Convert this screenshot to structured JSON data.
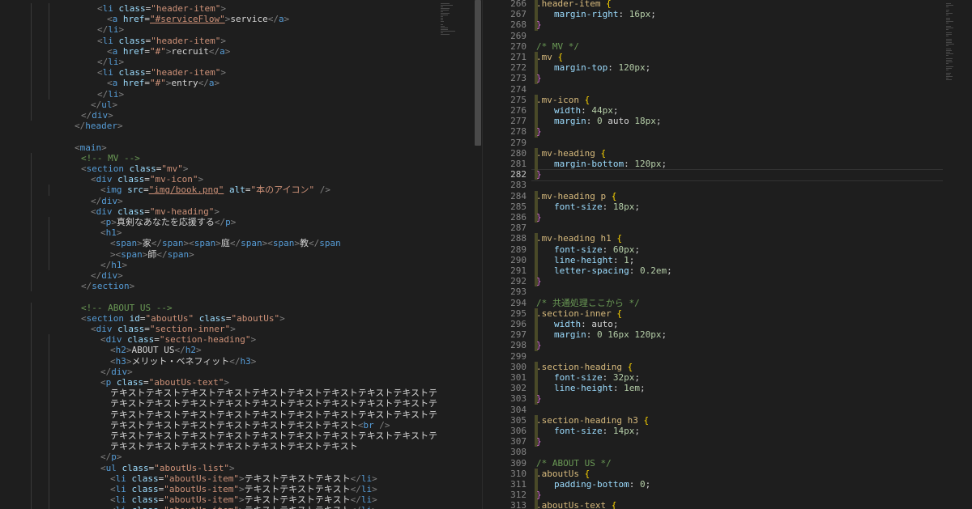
{
  "editor": {
    "left_pane": {
      "lines": [
        "<li class=\"header-item\">",
        "<a href=\"#serviceFlow\">service</a>",
        "</li>",
        "<li class=\"header-item\">",
        "<a href=\"#\">recruit</a>",
        "</li>",
        "<li class=\"header-item\">",
        "<a href=\"#\">entry</a>",
        "</li>",
        "</ul>",
        "</div>",
        "</header>",
        "",
        "<main>",
        "<!-- MV -->",
        "<section class=\"mv\">",
        "<div class=\"mv-icon\">",
        "<img src=\"img/book.png\" alt=\"本のアイコン\" />",
        "</div>",
        "<div class=\"mv-heading\">",
        "<p>真剣なあなたを応援する</p>",
        "<h1>",
        "<span>家</span><span>庭</span><span>教</span",
        "><span>師</span>",
        "</h1>",
        "</div>",
        "</section>",
        "",
        "<!-- ABOUT US -->",
        "<section id=\"aboutUs\" class=\"aboutUs\">",
        "<div class=\"section-inner\">",
        "<div class=\"section-heading\">",
        "<h2>ABOUT US</h2>",
        "<h3>メリット・ベネフィット</h3>",
        "</div>",
        "<p class=\"aboutUs-text\">",
        "テキストテキストテキストテキストテキストテキストテキストテキストテキストテキストテ",
        "テキストテキストテキストテキストテキストテキストテキストテキストテキストテキストテ",
        "テキストテキストテキストテキストテキストテキストテキストテキストテキストテキストテ",
        "テキストテキストテキストテキストテキストテキストテキスト<br />",
        "テキストテキストテキストテキストテキストテキストテキストテキストテキストテキストテ",
        "テキストテキストテキストテキストテキストテキストテキスト",
        "</p>",
        "<ul class=\"aboutUs-list\">",
        "<li class=\"aboutUs-item\">テキストテキストテキスト</li>",
        "<li class=\"aboutUs-item\">テキストテキストテキスト</li>",
        "<li class=\"aboutUs-item\">テキストテキストテキスト</li>",
        "<li class=\"aboutUs-item\">テキストテキストテキスト</li>"
      ]
    },
    "right_pane": {
      "active_line": "282",
      "lines": [
        {
          "n": "266",
          "t": ".header-item {"
        },
        {
          "n": "267",
          "t": "margin-right: 16px;"
        },
        {
          "n": "268",
          "t": "}"
        },
        {
          "n": "269",
          "t": ""
        },
        {
          "n": "270",
          "t": "/* MV */"
        },
        {
          "n": "271",
          "t": ".mv {"
        },
        {
          "n": "272",
          "t": "margin-top: 120px;"
        },
        {
          "n": "273",
          "t": "}"
        },
        {
          "n": "274",
          "t": ""
        },
        {
          "n": "275",
          "t": ".mv-icon {"
        },
        {
          "n": "276",
          "t": "width: 44px;"
        },
        {
          "n": "277",
          "t": "margin: 0 auto 18px;"
        },
        {
          "n": "278",
          "t": "}"
        },
        {
          "n": "279",
          "t": ""
        },
        {
          "n": "280",
          "t": ".mv-heading {"
        },
        {
          "n": "281",
          "t": "margin-bottom: 120px;"
        },
        {
          "n": "282",
          "t": "}"
        },
        {
          "n": "283",
          "t": ""
        },
        {
          "n": "284",
          "t": ".mv-heading p {"
        },
        {
          "n": "285",
          "t": "font-size: 18px;"
        },
        {
          "n": "286",
          "t": "}"
        },
        {
          "n": "287",
          "t": ""
        },
        {
          "n": "288",
          "t": ".mv-heading h1 {"
        },
        {
          "n": "289",
          "t": "font-size: 60px;"
        },
        {
          "n": "290",
          "t": "line-height: 1;"
        },
        {
          "n": "291",
          "t": "letter-spacing: 0.2em;"
        },
        {
          "n": "292",
          "t": "}"
        },
        {
          "n": "293",
          "t": ""
        },
        {
          "n": "294",
          "t": "/* 共通処理ここから */"
        },
        {
          "n": "295",
          "t": ".section-inner {"
        },
        {
          "n": "296",
          "t": "width: auto;"
        },
        {
          "n": "297",
          "t": "margin: 0 16px 120px;"
        },
        {
          "n": "298",
          "t": "}"
        },
        {
          "n": "299",
          "t": ""
        },
        {
          "n": "300",
          "t": ".section-heading {"
        },
        {
          "n": "301",
          "t": "font-size: 32px;"
        },
        {
          "n": "302",
          "t": "line-height: 1em;"
        },
        {
          "n": "303",
          "t": "}"
        },
        {
          "n": "304",
          "t": ""
        },
        {
          "n": "305",
          "t": ".section-heading h3 {"
        },
        {
          "n": "306",
          "t": "font-size: 14px;"
        },
        {
          "n": "307",
          "t": "}"
        },
        {
          "n": "308",
          "t": ""
        },
        {
          "n": "309",
          "t": "/* ABOUT US */"
        },
        {
          "n": "310",
          "t": ".aboutUs {"
        },
        {
          "n": "311",
          "t": "padding-bottom: 0;"
        },
        {
          "n": "312",
          "t": "}"
        },
        {
          "n": "313",
          "t": ".aboutUs-text {"
        }
      ]
    }
  },
  "colors": {
    "background": "#1e1e1e",
    "tag": "#569cd6",
    "attribute": "#9cdcfe",
    "string": "#ce9178",
    "comment": "#6a9955",
    "selector": "#d7ba7d",
    "number": "#b5cea8",
    "brace": "#da70d6",
    "line_number": "#858585"
  }
}
